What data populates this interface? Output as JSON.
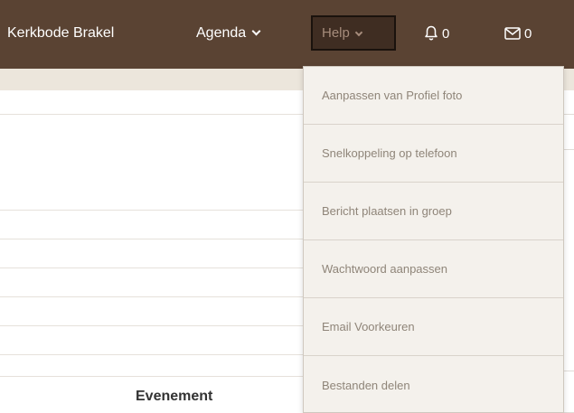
{
  "navbar": {
    "brand": "Kerkbode Brakel",
    "agenda_label": "Agenda",
    "help_label": "Help",
    "notifications_count": "0",
    "messages_count": "0"
  },
  "help_menu": {
    "items": [
      {
        "label": "Aanpassen van Profiel foto"
      },
      {
        "label": "Snelkoppeling op telefoon"
      },
      {
        "label": "Bericht plaatsen in groep"
      },
      {
        "label": "Wachtwoord aanpassen"
      },
      {
        "label": "Email Voorkeuren"
      },
      {
        "label": "Bestanden delen"
      }
    ]
  },
  "main": {
    "column_label": "Evenement"
  },
  "colors": {
    "navbar_bg": "#5a4333",
    "dropdown_bg": "#f4f1ec",
    "subbar_bg": "#ece6dc"
  }
}
